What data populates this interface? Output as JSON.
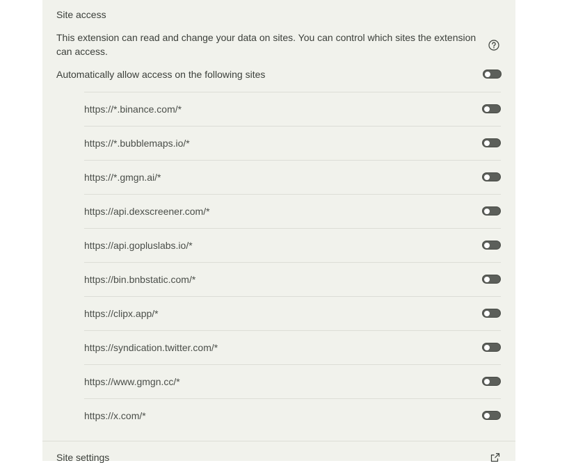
{
  "site_access": {
    "title": "Site access",
    "description": "This extension can read and change your data on sites. You can control which sites the extension can access.",
    "auto_allow_label": "Automatically allow access on the following sites",
    "auto_allow_enabled": false,
    "sites": [
      {
        "url": "https://*.binance.com/*",
        "enabled": false
      },
      {
        "url": "https://*.bubblemaps.io/*",
        "enabled": false
      },
      {
        "url": "https://*.gmgn.ai/*",
        "enabled": false
      },
      {
        "url": "https://api.dexscreener.com/*",
        "enabled": false
      },
      {
        "url": "https://api.gopluslabs.io/*",
        "enabled": false
      },
      {
        "url": "https://bin.bnbstatic.com/*",
        "enabled": false
      },
      {
        "url": "https://clipx.app/*",
        "enabled": false
      },
      {
        "url": "https://syndication.twitter.com/*",
        "enabled": false
      },
      {
        "url": "https://www.gmgn.cc/*",
        "enabled": false
      },
      {
        "url": "https://x.com/*",
        "enabled": false
      }
    ]
  },
  "site_settings": {
    "label": "Site settings",
    "icon": "external-link-icon"
  },
  "icons": {
    "help": "help-circle-icon"
  },
  "colors": {
    "panel_bg": "#f1f2ec",
    "toggle_off": "#5c5f5a",
    "divider": "#dcddd6"
  }
}
